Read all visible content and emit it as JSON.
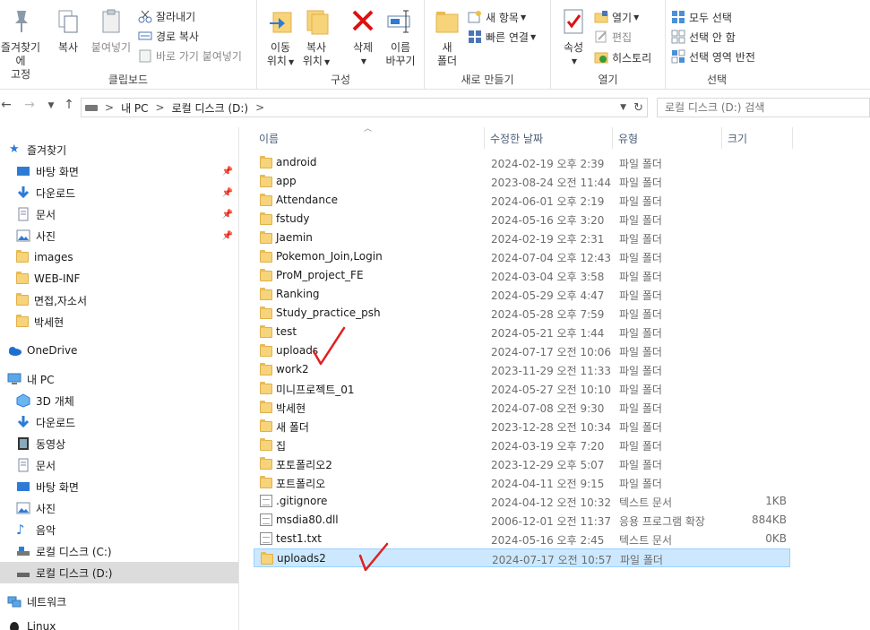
{
  "ribbon": {
    "clipboard": {
      "label": "클립보드",
      "pin_label_1": "즐겨찾기에",
      "pin_label_2": "고정",
      "copy_label": "복사",
      "paste_label": "붙여넣기",
      "cut_label": "잘라내기",
      "copy_path_label": "경로 복사",
      "paste_shortcut_label": "바로 가기 붙여넣기"
    },
    "organize": {
      "label": "구성",
      "move_label_1": "이동",
      "move_label_2": "위치",
      "copyto_label_1": "복사",
      "copyto_label_2": "위치",
      "delete_label": "삭제",
      "rename_label_1": "이름",
      "rename_label_2": "바꾸기"
    },
    "new": {
      "label": "새로 만들기",
      "newfolder_label_1": "새",
      "newfolder_label_2": "폴더",
      "newitem_label": "새 항목",
      "easyaccess_label": "빠른 연결"
    },
    "open": {
      "label": "열기",
      "properties_label": "속성",
      "open_label": "열기",
      "edit_label": "편집",
      "history_label": "히스토리"
    },
    "select": {
      "label": "선택",
      "select_all_label": "모두 선택",
      "select_none_label": "선택 안 함",
      "invert_label": "선택 영역 반전"
    }
  },
  "address": {
    "path": [
      "내 PC",
      "로컬 디스크 (D:)"
    ],
    "separator": ">",
    "search_placeholder": "로컬 디스크 (D:) 검색"
  },
  "nav": {
    "quick_access": "즐겨찾기",
    "quick_items": [
      "바탕 화면",
      "다운로드",
      "문서",
      "사진",
      "images",
      "WEB-INF",
      "면접,자소서",
      "박세현"
    ],
    "onedrive": "OneDrive",
    "thispc": "내 PC",
    "pc_items": [
      "3D 개체",
      "다운로드",
      "동영상",
      "문서",
      "바탕 화면",
      "사진",
      "음악",
      "로컬 디스크 (C:)",
      "로컬 디스크 (D:)"
    ],
    "network": "네트워크",
    "linux": "Linux"
  },
  "columns": {
    "name": "이름",
    "date": "수정한 날짜",
    "type": "유형",
    "size": "크기"
  },
  "files": [
    {
      "name": "android",
      "date": "2024-02-19 오후 2:39",
      "type": "파일 폴더",
      "size": "",
      "kind": "folder"
    },
    {
      "name": "app",
      "date": "2023-08-24 오전 11:44",
      "type": "파일 폴더",
      "size": "",
      "kind": "folder"
    },
    {
      "name": "Attendance",
      "date": "2024-06-01 오후 2:19",
      "type": "파일 폴더",
      "size": "",
      "kind": "folder"
    },
    {
      "name": "fstudy",
      "date": "2024-05-16 오후 3:20",
      "type": "파일 폴더",
      "size": "",
      "kind": "folder"
    },
    {
      "name": "Jaemin",
      "date": "2024-02-19 오후 2:31",
      "type": "파일 폴더",
      "size": "",
      "kind": "folder"
    },
    {
      "name": "Pokemon_Join,Login",
      "date": "2024-07-04 오후 12:43",
      "type": "파일 폴더",
      "size": "",
      "kind": "folder"
    },
    {
      "name": "ProM_project_FE",
      "date": "2024-03-04 오후 3:58",
      "type": "파일 폴더",
      "size": "",
      "kind": "folder"
    },
    {
      "name": "Ranking",
      "date": "2024-05-29 오후 4:47",
      "type": "파일 폴더",
      "size": "",
      "kind": "folder"
    },
    {
      "name": "Study_practice_psh",
      "date": "2024-05-28 오후 7:59",
      "type": "파일 폴더",
      "size": "",
      "kind": "folder"
    },
    {
      "name": "test",
      "date": "2024-05-21 오후 1:44",
      "type": "파일 폴더",
      "size": "",
      "kind": "folder"
    },
    {
      "name": "uploads",
      "date": "2024-07-17 오전 10:06",
      "type": "파일 폴더",
      "size": "",
      "kind": "folder"
    },
    {
      "name": "work2",
      "date": "2023-11-29 오전 11:33",
      "type": "파일 폴더",
      "size": "",
      "kind": "folder"
    },
    {
      "name": "미니프로젝트_01",
      "date": "2024-05-27 오전 10:10",
      "type": "파일 폴더",
      "size": "",
      "kind": "folder"
    },
    {
      "name": "박세현",
      "date": "2024-07-08 오전 9:30",
      "type": "파일 폴더",
      "size": "",
      "kind": "folder"
    },
    {
      "name": "새 폴더",
      "date": "2023-12-28 오전 10:34",
      "type": "파일 폴더",
      "size": "",
      "kind": "folder"
    },
    {
      "name": "집",
      "date": "2024-03-19 오후 7:20",
      "type": "파일 폴더",
      "size": "",
      "kind": "folder"
    },
    {
      "name": "포토폴리오2",
      "date": "2023-12-29 오후 5:07",
      "type": "파일 폴더",
      "size": "",
      "kind": "folder"
    },
    {
      "name": "포트폴리오",
      "date": "2024-04-11 오전 9:15",
      "type": "파일 폴더",
      "size": "",
      "kind": "folder"
    },
    {
      "name": ".gitignore",
      "date": "2024-04-12 오전 10:32",
      "type": "텍스트 문서",
      "size": "1KB",
      "kind": "file"
    },
    {
      "name": "msdia80.dll",
      "date": "2006-12-01 오전 11:37",
      "type": "응용 프로그램 확장",
      "size": "884KB",
      "kind": "dll"
    },
    {
      "name": "test1.txt",
      "date": "2024-05-16 오후 2:45",
      "type": "텍스트 문서",
      "size": "0KB",
      "kind": "file"
    },
    {
      "name": "uploads2",
      "date": "2024-07-17 오전 10:57",
      "type": "파일 폴더",
      "size": "",
      "kind": "folder"
    }
  ],
  "colors": {
    "selection_bg": "#cce8ff",
    "selection_border": "#99d1ff",
    "folder": "#f7d37a",
    "annotation": "#e02020"
  }
}
